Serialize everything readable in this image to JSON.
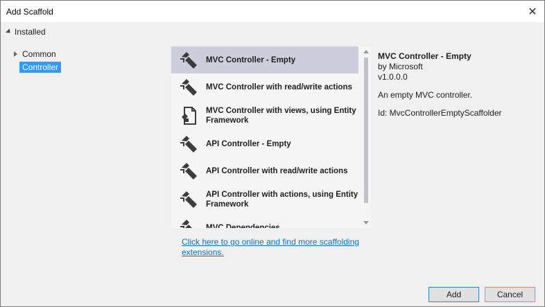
{
  "window": {
    "title": "Add Scaffold",
    "close_glyph": "✕"
  },
  "left": {
    "installed_label": "Installed",
    "tree": [
      {
        "label": "Common",
        "expandable": true
      },
      {
        "label": "Controller",
        "selected": true
      }
    ]
  },
  "list": {
    "selected_index": 0,
    "items": [
      {
        "label": "MVC Controller - Empty",
        "icon": "controller-icon"
      },
      {
        "label": "MVC Controller with read/write actions",
        "icon": "controller-icon"
      },
      {
        "label": "MVC Controller with views, using Entity Framework",
        "icon": "document-icon"
      },
      {
        "label": "API Controller - Empty",
        "icon": "controller-icon"
      },
      {
        "label": "API Controller with read/write actions",
        "icon": "controller-icon"
      },
      {
        "label": "API Controller with actions, using Entity Framework",
        "icon": "controller-icon"
      },
      {
        "label": "MVC Dependencies",
        "icon": "controller-icon"
      }
    ]
  },
  "link_text": "Click here to go online and find more scaffolding extensions.",
  "details": {
    "title": "MVC Controller - Empty",
    "author": "by Microsoft",
    "version": "v1.0.0.0",
    "description": "An empty MVC controller.",
    "id": "Id: MvcControllerEmptyScaffolder"
  },
  "buttons": {
    "add": "Add",
    "cancel": "Cancel"
  },
  "colors": {
    "selection": "#3399ff",
    "list_selected": "#cccedb",
    "link": "#0e70c0",
    "icon": "#3c3c3c"
  }
}
